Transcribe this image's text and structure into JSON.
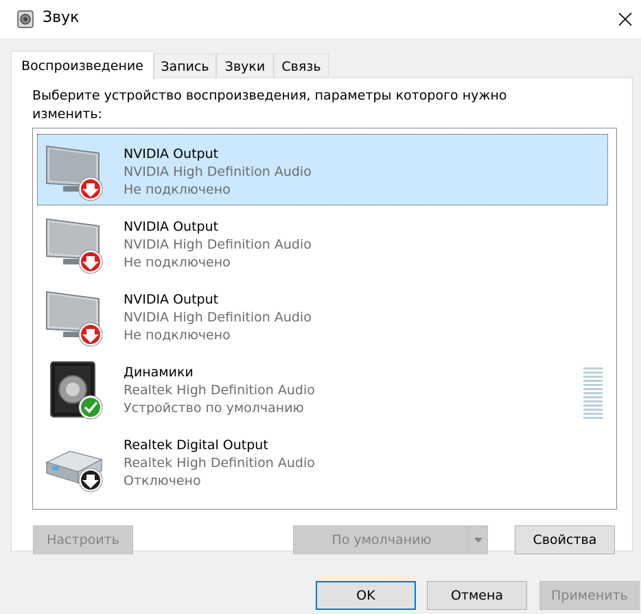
{
  "window": {
    "title": "Звук"
  },
  "tabs": [
    {
      "label": "Воспроизведение",
      "active": true
    },
    {
      "label": "Запись",
      "active": false
    },
    {
      "label": "Звуки",
      "active": false
    },
    {
      "label": "Связь",
      "active": false
    }
  ],
  "instruction": "Выберите устройство воспроизведения, параметры которого нужно изменить:",
  "devices": [
    {
      "name": "NVIDIA Output",
      "driver": "NVIDIA High Definition Audio",
      "status": "Не подключено",
      "icon": "monitor-icon",
      "badge": "disconnected-badge-icon",
      "selected": true
    },
    {
      "name": "NVIDIA Output",
      "driver": "NVIDIA High Definition Audio",
      "status": "Не подключено",
      "icon": "monitor-icon",
      "badge": "disconnected-badge-icon",
      "selected": false
    },
    {
      "name": "NVIDIA Output",
      "driver": "NVIDIA High Definition Audio",
      "status": "Не подключено",
      "icon": "monitor-icon",
      "badge": "disconnected-badge-icon",
      "selected": false
    },
    {
      "name": "Динамики",
      "driver": "Realtek High Definition Audio",
      "status": "Устройство по умолчанию",
      "icon": "speaker-icon",
      "badge": "default-check-icon",
      "selected": false
    },
    {
      "name": "Realtek Digital Output",
      "driver": "Realtek High Definition Audio",
      "status": "Отключено",
      "icon": "digital-output-icon",
      "badge": "disabled-badge-icon",
      "selected": false
    }
  ],
  "buttons": {
    "configure": "Настроить",
    "set_default": "По умолчанию",
    "properties": "Свойства",
    "ok": "OK",
    "cancel": "Отмена",
    "apply": "Применить"
  },
  "colors": {
    "selection": "#cce8ff",
    "disconnected_badge": "#d81e1e",
    "default_badge": "#2a9d2a",
    "focus_border": "#0078d7"
  }
}
